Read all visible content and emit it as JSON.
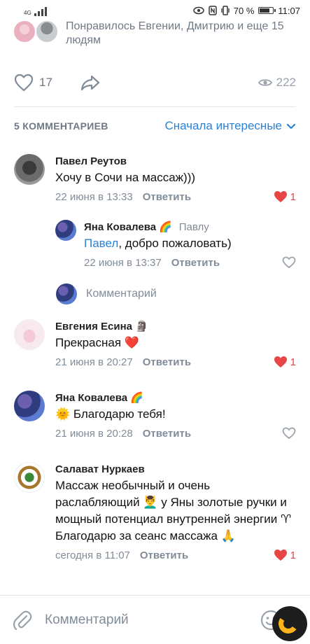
{
  "status_bar": {
    "network_label": "4G",
    "battery_percent_text": "70 %",
    "battery_level": 0.7,
    "time": "11:07"
  },
  "post": {
    "liked_by_text": "Понравилось Евгении, Дмитрию и еще 15 людям",
    "likes_count": "17",
    "views_count": "222"
  },
  "comments_section": {
    "count_label": "5 КОММЕНТАРИЕВ",
    "sort_label": "Сначала интересные"
  },
  "comments": [
    {
      "author": "Павел Реутов",
      "text": "Хочу в Сочи на массаж)))",
      "date": "22 июня в 13:33",
      "reply_label": "Ответить",
      "likes": "1"
    },
    {
      "author": "Яна Ковалева",
      "author_emoji": "🌈",
      "reply_to": "Павлу",
      "mention": "Павел",
      "text": ", добро пожаловать)",
      "date": "22 июня в 13:37",
      "reply_label": "Ответить"
    },
    {
      "author": "Евгения Есина",
      "author_emoji": "🗿",
      "text": "Прекрасная ❤️",
      "date": "21 июня в 20:27",
      "reply_label": "Ответить",
      "likes": "1"
    },
    {
      "author": "Яна Ковалева",
      "author_emoji": "🌈",
      "text": "🌞 Благодарю тебя!",
      "date": "21 июня в 20:28",
      "reply_label": "Ответить"
    },
    {
      "author": "Салават Нуркаев",
      "text": "Массаж необычный и очень раслабляющий 💆‍♂️ у Яны золотые ручки и мощный потенциал внутренней энергии ♈ Благодарю за сеанс массажа 🙏",
      "date": "сегодня в 11:07",
      "reply_label": "Ответить",
      "likes": "1"
    }
  ],
  "reply_input": {
    "placeholder": "Комментарий"
  },
  "composer": {
    "placeholder": "Комментарий"
  },
  "colors": {
    "accent": "#2a82d8",
    "like_red": "#e64646",
    "secondary_text": "#818c99"
  }
}
